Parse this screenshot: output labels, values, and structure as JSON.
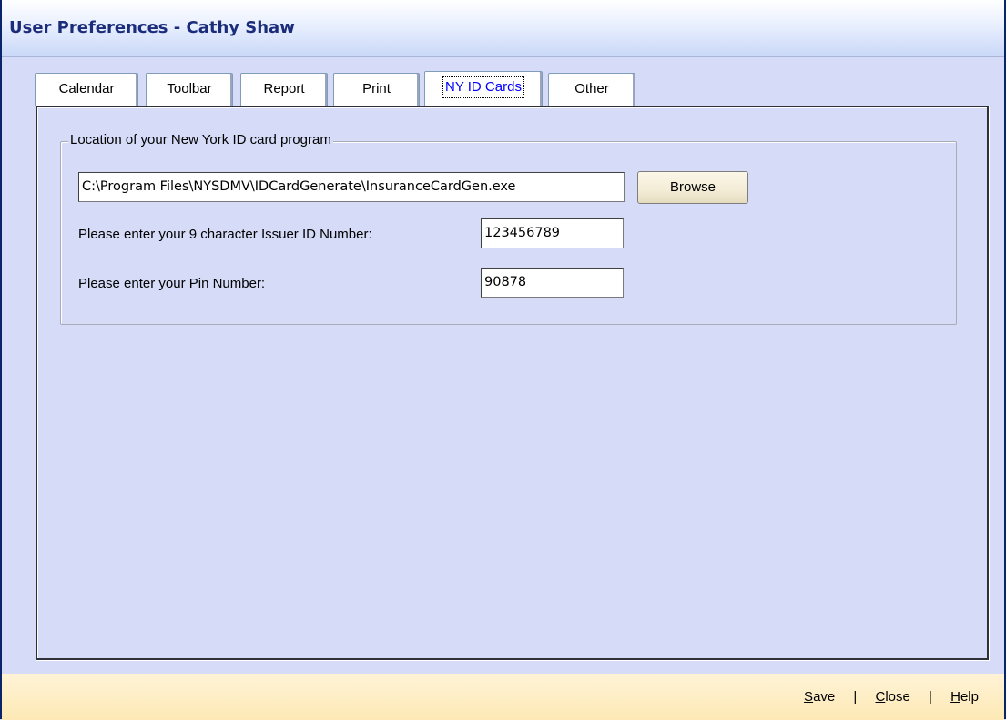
{
  "window": {
    "title": "User Preferences  -  Cathy Shaw"
  },
  "tabs": [
    {
      "label": "Calendar"
    },
    {
      "label": "Toolbar"
    },
    {
      "label": "Report"
    },
    {
      "label": "Print"
    },
    {
      "label": "NY ID Cards",
      "active": true
    },
    {
      "label": "Other"
    }
  ],
  "nyid": {
    "group_label": "Location of your New York ID card program",
    "program_path": "C:\\Program Files\\NYSDMV\\IDCardGenerate\\InsuranceCardGen.exe",
    "browse_label": "Browse",
    "issuer_label": "Please enter your 9 character Issuer ID Number:",
    "issuer_value": "123456789",
    "pin_label": "Please enter your Pin Number:",
    "pin_value": "90878"
  },
  "footer": {
    "save_first": "S",
    "save_rest": "ave",
    "close_first": "C",
    "close_rest": "lose",
    "help_first": "H",
    "help_rest": "elp",
    "separator": "|"
  },
  "colors": {
    "window_bg": "#d6dcf8",
    "title_text": "#1b2d7a",
    "active_tab_text": "#0000ff",
    "statusbar_bg": "#fde9b5"
  }
}
